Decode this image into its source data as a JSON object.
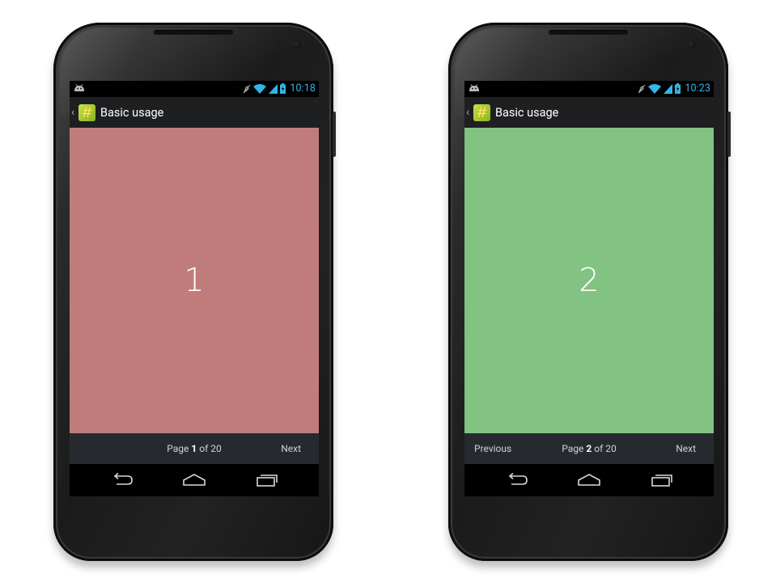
{
  "phones": [
    {
      "status": {
        "time": "10:18"
      },
      "actionbar": {
        "title": "Basic usage",
        "app_icon_glyph": "#"
      },
      "page": {
        "number": "1",
        "color": "#c07c7b"
      },
      "pager": {
        "previous_label": "",
        "page_prefix": "Page ",
        "current_page": "1",
        "page_suffix": " of 20",
        "next_label": "Next"
      }
    },
    {
      "status": {
        "time": "10:23"
      },
      "actionbar": {
        "title": "Basic usage",
        "app_icon_glyph": "#"
      },
      "page": {
        "number": "2",
        "color": "#82c283"
      },
      "pager": {
        "previous_label": "Previous",
        "page_prefix": "Page ",
        "current_page": "2",
        "page_suffix": " of 20",
        "next_label": "Next"
      }
    }
  ],
  "colors": {
    "status_accent": "#33b5e5",
    "actionbar_bg": "#1e1f21",
    "pager_bg": "#262a2e"
  },
  "icons": [
    "android-icon",
    "mute-icon",
    "wifi-icon",
    "signal-icon",
    "battery-icon",
    "back-icon",
    "home-icon",
    "recents-icon"
  ]
}
